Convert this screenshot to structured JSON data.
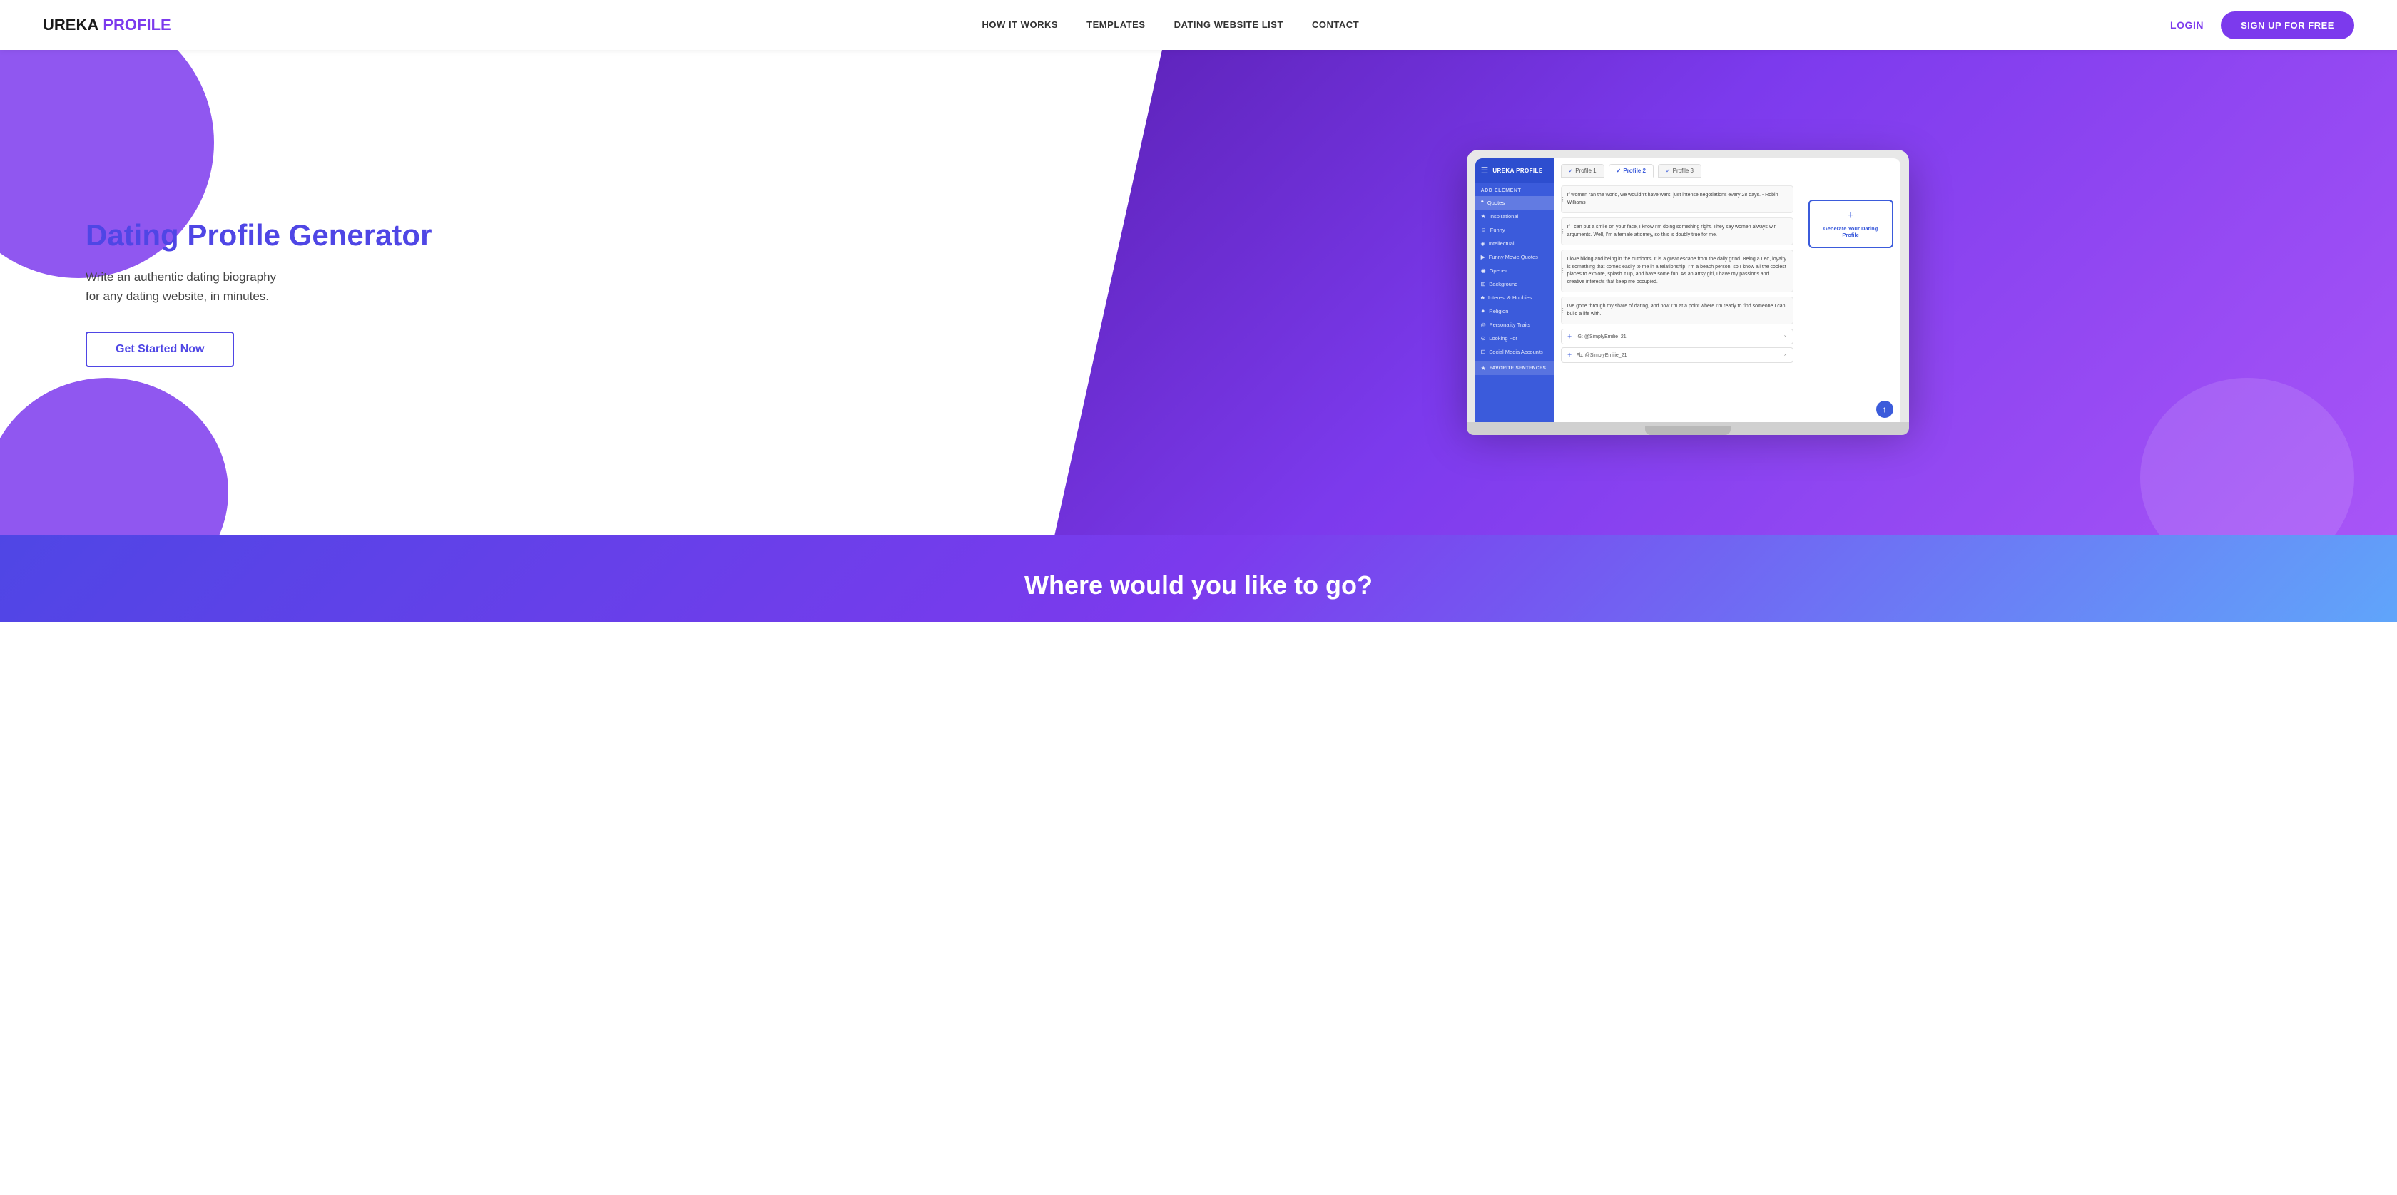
{
  "brand": {
    "name_ureka": "UREKA",
    "name_profile": "PROFILE"
  },
  "navbar": {
    "links": [
      {
        "label": "HOW IT WORKS",
        "href": "#how-it-works"
      },
      {
        "label": "TEMPLATES",
        "href": "#templates"
      },
      {
        "label": "DATING WEBSITE LIST",
        "href": "#dating-website-list"
      },
      {
        "label": "CONTACT",
        "href": "#contact"
      }
    ],
    "login_label": "LOGIN",
    "signup_label": "SIGN UP FOR FREE"
  },
  "hero": {
    "title": "Dating Profile Generator",
    "subtitle_line1": "Write an authentic dating biography",
    "subtitle_line2": "for any dating website, in minutes.",
    "cta_label": "Get Started Now"
  },
  "app_mockup": {
    "sidebar_logo": "UREKA PROFILE",
    "sidebar_section": "ADD ELEMENT",
    "sidebar_items": [
      {
        "icon": "❝",
        "label": "Quotes",
        "active": true
      },
      {
        "icon": "★",
        "label": "Inspirational"
      },
      {
        "icon": "☺",
        "label": "Funny"
      },
      {
        "icon": "◈",
        "label": "Intellectual"
      },
      {
        "icon": "🎬",
        "label": "Funny Movie Quotes"
      },
      {
        "icon": "◉",
        "label": "Opener"
      },
      {
        "icon": "⊞",
        "label": "Background"
      },
      {
        "icon": "♣",
        "label": "Interest & Hobbies"
      },
      {
        "icon": "✦",
        "label": "Religion"
      },
      {
        "icon": "◎",
        "label": "Personality Traits"
      },
      {
        "icon": "⊙",
        "label": "Looking For"
      },
      {
        "icon": "⊟",
        "label": "Social Media Accounts"
      },
      {
        "icon": "★",
        "label": "FAVORITE SENTENCES",
        "fav": true
      }
    ],
    "tabs": [
      {
        "label": "Profile 1"
      },
      {
        "label": "Profile 2",
        "active": true
      },
      {
        "label": "Profile 3"
      }
    ],
    "text_blocks": [
      "If women ran the world, we wouldn't have wars, just intense negotiations every 28 days. - Robin Williams",
      "If I can put a smile on your face, I know I'm doing something right. They say women always win arguments. Well, I'm a female attorney, so this is doubly true for me.",
      "I love hiking and being in the outdoors. It is a great escape from the daily grind. Being a Leo, loyalty is something that comes easily to me in a relationship. I'm a beach person, so I know all the coolest places to explore, splash it up, and have some fun. As an artsy girl, I have my passions and creative interests that keep me occupied.",
      "I've gone through my share of dating, and now I'm at a point where I'm ready to find someone I can build a life with."
    ],
    "input_rows": [
      {
        "placeholder": "IG: @SimplyEmilie_21"
      },
      {
        "placeholder": "Fb: @SimplyEmilie_21"
      }
    ],
    "generate_label": "Generate Your Dating Profile"
  },
  "bottom": {
    "title": "Where would you like to go?"
  }
}
